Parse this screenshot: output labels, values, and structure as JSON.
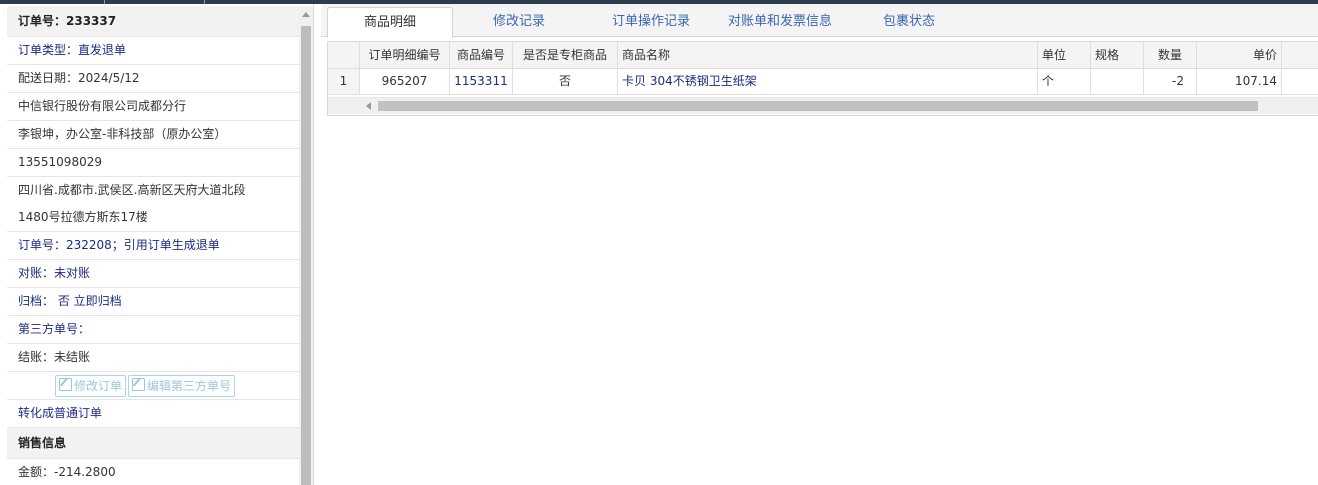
{
  "order_panel": {
    "order_no": "订单号：233337",
    "order_type": "订单类型：直发退单",
    "delivery_date": "配送日期：2024/5/12",
    "customer": "中信银行股份有限公司成都分行",
    "contact": "李银坤，办公室-非科技部（原办公室）",
    "phone": "13551098029",
    "address_line1": "四川省.成都市.武侯区.高新区天府大道北段",
    "address_line2": "1480号拉德方斯东17楼",
    "ref_order": "订单号：232208；引用订单生成退单",
    "reconcile": "对账：未对账",
    "archive": "归档： 否 立即归档",
    "third_party_no": "第三方单号：",
    "settlement": "结账：未结账",
    "edit_order_button": "修改订单",
    "edit_third_party_button": "编辑第三方单号",
    "convert_link": "转化成普通订单",
    "sales_section_title": "销售信息",
    "amount": "金额：-214.2800"
  },
  "tabs": [
    {
      "label": "商品明细",
      "active": true
    },
    {
      "label": "修改记录",
      "active": false
    },
    {
      "label": "订单操作记录",
      "active": false
    },
    {
      "label": "对账单和发票信息",
      "active": false
    },
    {
      "label": "包裹状态",
      "active": false
    }
  ],
  "grid": {
    "columns": [
      "订单明细编号",
      "商品编号",
      "是否是专柜商品",
      "商品名称",
      "单位",
      "规格",
      "数量",
      "单价"
    ],
    "rows": [
      {
        "row_no": "1",
        "detail_id": "965207",
        "product_id": "1153311",
        "is_counter": "否",
        "product_name": "卡贝 304不锈钢卫生纸架",
        "unit": "个",
        "spec": "",
        "quantity": "-2",
        "unit_price": "107.14"
      }
    ]
  },
  "colors": {
    "topbar": "#2d3c4d",
    "link_blue": "#1f2a86",
    "tab_blue": "#3a66b0"
  }
}
